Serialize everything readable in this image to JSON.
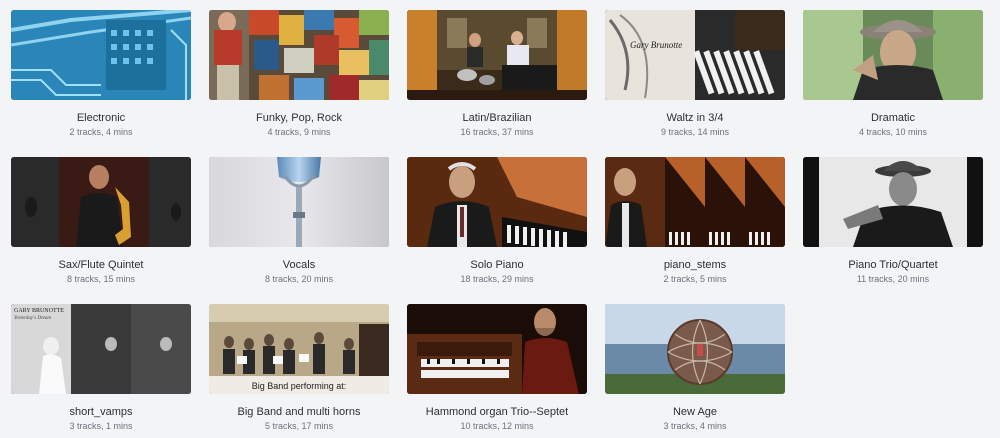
{
  "playlists": [
    {
      "name": "Electronic",
      "meta": "2 tracks, 4 mins",
      "thumb": "circuit-board"
    },
    {
      "name": "Funky, Pop, Rock",
      "meta": "4 tracks, 9 mins",
      "thumb": "mosaic-painter"
    },
    {
      "name": "Latin/Brazilian",
      "meta": "16 tracks, 37 mins",
      "thumb": "band-stage"
    },
    {
      "name": "Waltz in 3/4",
      "meta": "9 tracks, 14 mins",
      "thumb": "piano-album"
    },
    {
      "name": "Dramatic",
      "meta": "4 tracks, 10 mins",
      "thumb": "man-with-hat"
    },
    {
      "name": "Sax/Flute Quintet",
      "meta": "8 tracks, 15 mins",
      "thumb": "saxophone-player"
    },
    {
      "name": "Vocals",
      "meta": "8 tracks, 20 mins",
      "thumb": "vintage-microphone"
    },
    {
      "name": "Solo Piano",
      "meta": "18 tracks, 29 mins",
      "thumb": "pianist"
    },
    {
      "name": "piano_stems",
      "meta": "2 tracks, 5 mins",
      "thumb": "pianist-triptych"
    },
    {
      "name": "Piano Trio/Quartet",
      "meta": "11 tracks, 20 mins",
      "thumb": "man-with-hat-bw"
    },
    {
      "name": "short_vamps",
      "meta": "3 tracks, 1 mins",
      "thumb": "child-photo",
      "thumb_text": [
        "GARY BRUNOTTE",
        "Yesterday's Dream"
      ]
    },
    {
      "name": "Big Band and multi horns",
      "meta": "5 tracks, 17 mins",
      "thumb": "big-band",
      "thumb_text": [
        "Big Band performing at:"
      ]
    },
    {
      "name": "Hammond organ Trio--Septet",
      "meta": "10 tracks, 12 mins",
      "thumb": "hammond-organ"
    },
    {
      "name": "New Age",
      "meta": "3 tracks, 4 mins",
      "thumb": "sphere-sculpture"
    }
  ]
}
